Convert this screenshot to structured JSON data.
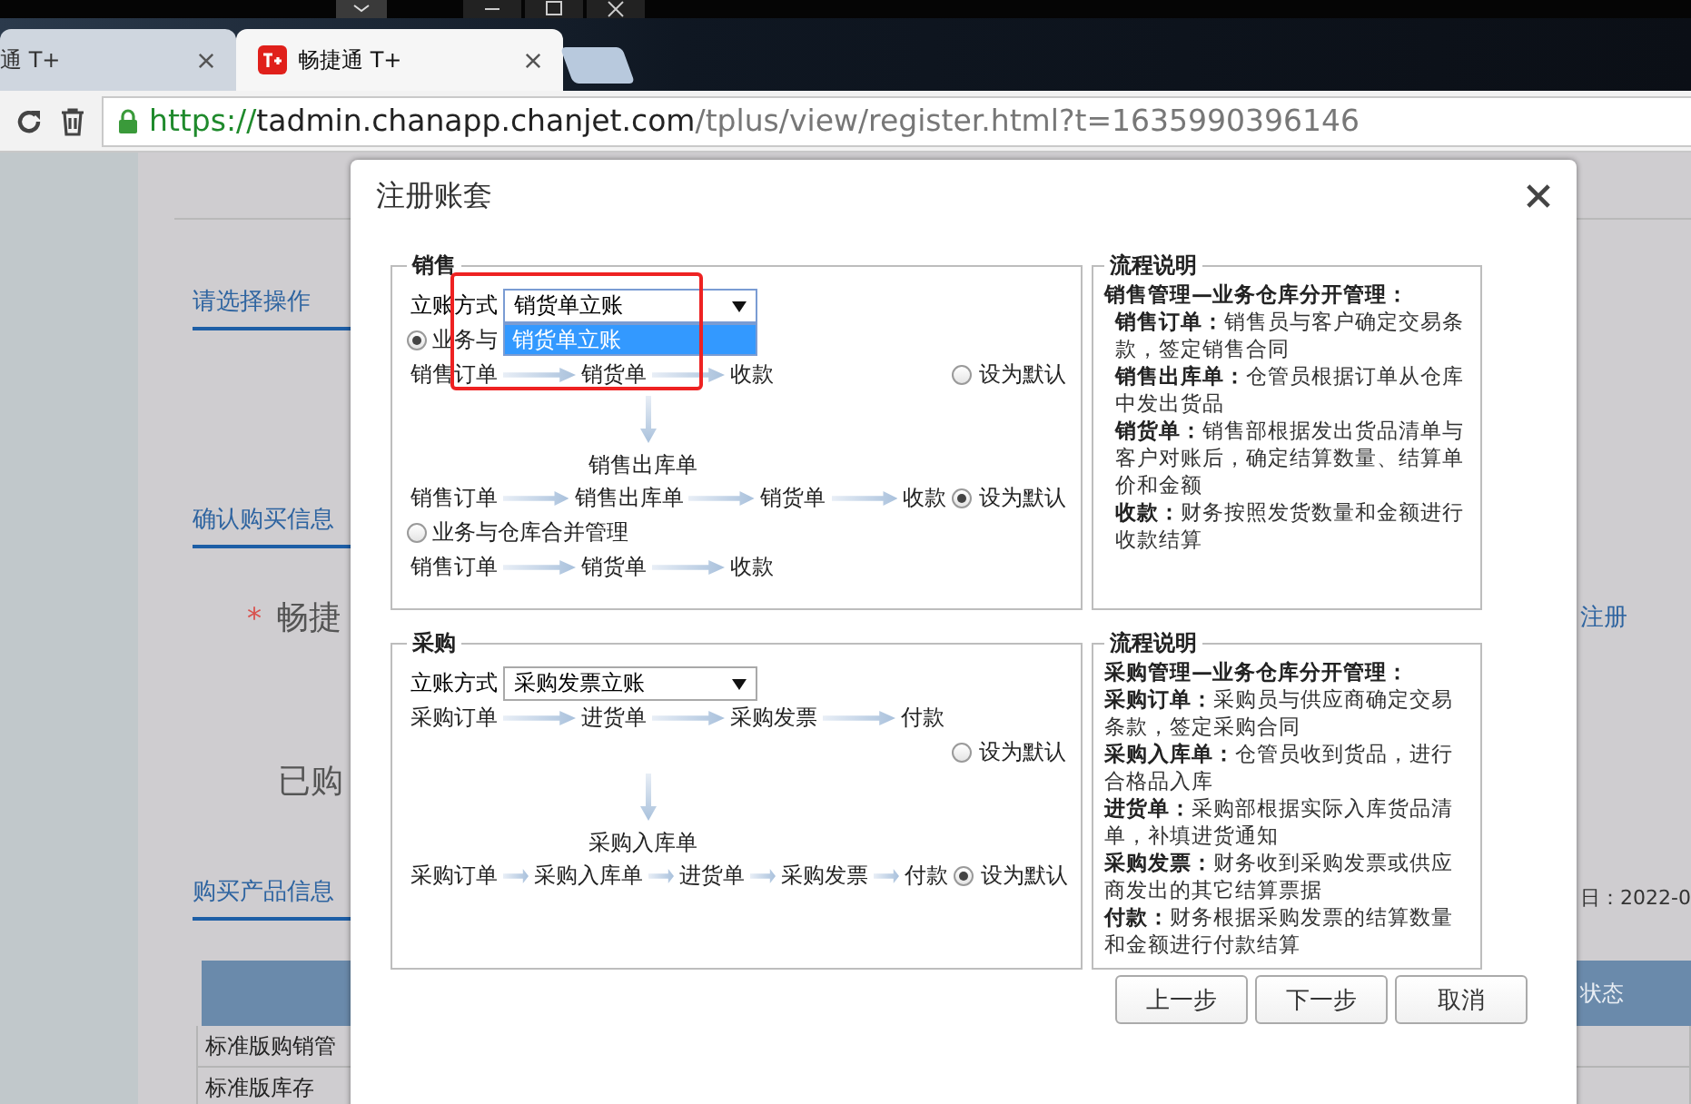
{
  "browser": {
    "tabs": [
      {
        "title": "通 T+",
        "selected": false
      },
      {
        "title": "畅捷通 T+",
        "selected": true
      }
    ],
    "address": {
      "scheme": "https://",
      "host": "tadmin.chanapp.chanjet.com",
      "path": "/tplus/view/register.html?t=1635990396146"
    }
  },
  "page": {
    "operation_heading": "请选择操作",
    "confirm_heading": "确认购买信息",
    "product_field": {
      "required_mark": "*",
      "label": "畅捷",
      "link": "注册"
    },
    "purchased_label": "已购",
    "product_heading": "购买产品信息",
    "date_text": "日：2022-0",
    "table": {
      "columns": [
        "状态"
      ],
      "rows": [
        [
          "标准版购销管"
        ],
        [
          "标准版库存"
        ]
      ]
    }
  },
  "dialog": {
    "title": "注册账套",
    "sections": [
      {
        "title": "销售",
        "method_label": "立账方式",
        "method_value": "销货单立账",
        "dropdown_open": true,
        "options": [
          {
            "label": "销货单立账",
            "selected": true
          }
        ],
        "lines": [
          {
            "kind": "radio",
            "label": "业务与",
            "selected": true
          },
          {
            "kind": "flow",
            "steps": [
              "销售订单",
              "销货单",
              "收款"
            ],
            "default": {
              "label": "设为默认",
              "selected": false
            }
          },
          {
            "kind": "branch",
            "label": "销售出库单"
          },
          {
            "kind": "flow",
            "steps": [
              "销售订单",
              "销售出库单",
              "销货单",
              "收款"
            ],
            "default": {
              "label": "设为默认",
              "selected": true
            }
          },
          {
            "kind": "radio",
            "label": "业务与仓库合并管理",
            "selected": false
          },
          {
            "kind": "flow",
            "steps": [
              "销售订单",
              "销货单",
              "收款"
            ]
          }
        ],
        "notes": {
          "title": "流程说明",
          "heading": "销售管理—业务仓库分开管理：",
          "indented": true,
          "items": [
            "**销售订单：**销售员与客户确定交易条款，签定销售合同",
            "**销售出库单：**仓管员根据订单从仓库中发出货品",
            "**销货单：**销售部根据发出货品清单与客户对账后，确定结算数量、结算单价和金额",
            "**收款：**财务按照发货数量和金额进行收款结算"
          ]
        }
      },
      {
        "title": "采购",
        "method_label": "立账方式",
        "method_value": "采购发票立账",
        "dropdown_open": false,
        "lines": [
          {
            "kind": "flow",
            "steps": [
              "采购订单",
              "进货单",
              "采购发票",
              "付款"
            ]
          },
          {
            "kind": "default",
            "label": "设为默认",
            "selected": false
          },
          {
            "kind": "branch",
            "label": "采购入库单"
          },
          {
            "kind": "flow",
            "steps": [
              "采购订单",
              "采购入库单",
              "进货单",
              "采购发票",
              "付款"
            ],
            "default": {
              "label": "设为默认",
              "selected": true
            }
          }
        ],
        "notes": {
          "title": "流程说明",
          "heading": "采购管理—业务仓库分开管理：",
          "indented": false,
          "items": [
            "**采购订单：**采购员与供应商确定交易条款，签定采购合同",
            "**采购入库单：**仓管员收到货品，进行合格品入库",
            "**进货单：**采购部根据实际入库货品清单，补填进货通知",
            "**采购发票：**财务收到采购发票或供应商发出的其它结算票据",
            "**付款：**财务根据采购发票的结算数量和金额进行付款结算"
          ]
        }
      }
    ],
    "buttons": [
      "上一步",
      "下一步",
      "取消"
    ]
  }
}
